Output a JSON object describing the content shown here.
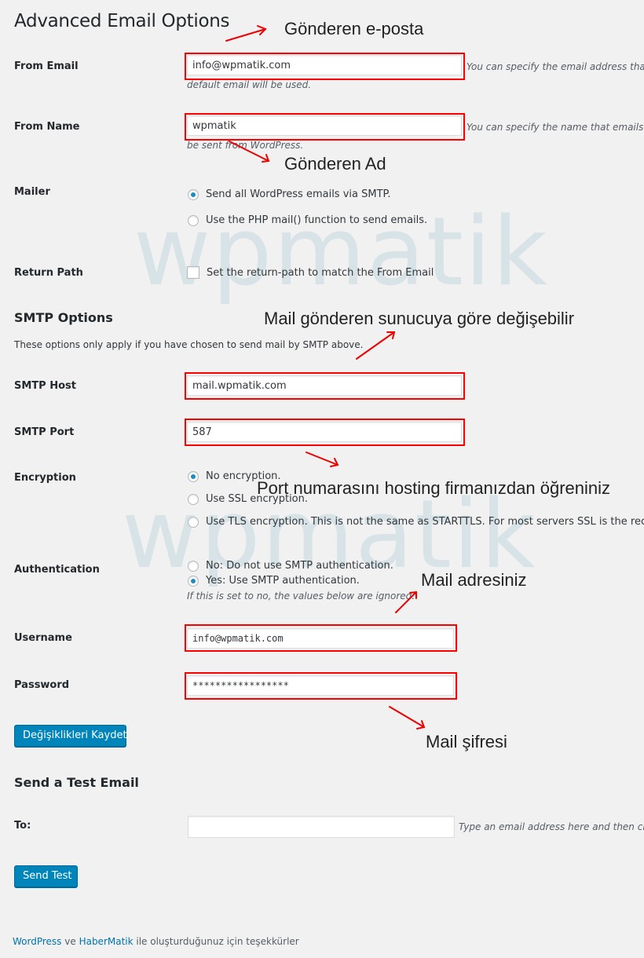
{
  "watermark": "wpmatik",
  "page_title": "Advanced Email Options",
  "from_email": {
    "label": "From Email",
    "value": "info@wpmatik.com",
    "description_line1": "You can specify the email address that e",
    "description_line2": "default email will be used."
  },
  "from_name": {
    "label": "From Name",
    "value": "wpmatik",
    "description_line1": "You can specify the name that emails sh",
    "description_line2": "be sent from WordPress."
  },
  "mailer": {
    "label": "Mailer",
    "options": [
      {
        "label": "Send all WordPress emails via SMTP.",
        "checked": true
      },
      {
        "label": "Use the PHP mail() function to send emails.",
        "checked": false
      }
    ]
  },
  "return_path": {
    "label": "Return Path",
    "checkbox_label": "Set the return-path to match the From Email",
    "checked": false
  },
  "smtp_options": {
    "title": "SMTP Options",
    "description": "These options only apply if you have chosen to send mail by SMTP above."
  },
  "smtp_host": {
    "label": "SMTP Host",
    "value": "mail.wpmatik.com"
  },
  "smtp_port": {
    "label": "SMTP Port",
    "value": "587"
  },
  "encryption": {
    "label": "Encryption",
    "options": [
      {
        "label": "No encryption.",
        "checked": true
      },
      {
        "label": "Use SSL encryption.",
        "checked": false
      },
      {
        "label": "Use TLS encryption. This is not the same as STARTTLS. For most servers SSL is the reco",
        "checked": false
      }
    ]
  },
  "authentication": {
    "label": "Authentication",
    "options": [
      {
        "label": "No: Do not use SMTP authentication.",
        "checked": false
      },
      {
        "label": "Yes: Use SMTP authentication.",
        "checked": true
      }
    ],
    "note": "If this is set to no, the values below are ignored."
  },
  "username": {
    "label": "Username",
    "value": "info@wpmatik.com"
  },
  "password": {
    "label": "Password",
    "value": "*****************"
  },
  "save_button": "Değişiklikleri Kaydet",
  "test_email": {
    "title": "Send a Test Email",
    "to_label": "To:",
    "to_value": "",
    "description": "Type an email address here and then click",
    "send_button": "Send Test"
  },
  "footer": {
    "link1": "WordPress",
    "connector": " ve ",
    "link2": "HaberMatik",
    "suffix": " ile oluşturduğunuz için teşekkürler"
  },
  "annotations": {
    "from_email": "Gönderen e-posta",
    "from_name": "Gönderen Ad",
    "smtp_host": "Mail gönderen sunucuya göre değişebilir",
    "smtp_port": "Port numarasını hosting firmanızdan öğreniniz",
    "username": "Mail adresiniz",
    "password": "Mail şifresi"
  },
  "colors": {
    "background": "#f1f1f1",
    "primary_button": "#0085ba",
    "highlight": "#ff0000",
    "link": "#0073aa",
    "watermark": "#b9d2dc"
  }
}
